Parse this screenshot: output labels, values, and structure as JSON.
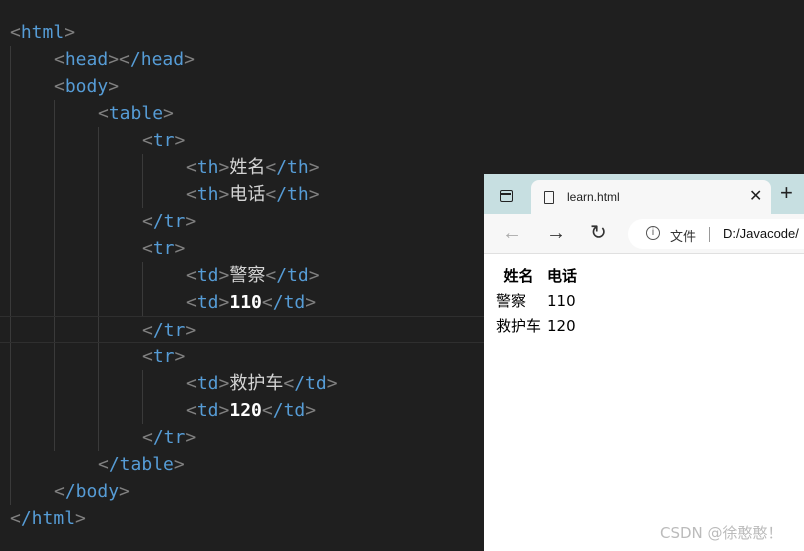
{
  "editor": {
    "html_open": "html",
    "head_open": "head",
    "head_close": "/head",
    "body_open": "body",
    "table_open": "table",
    "tr": "tr",
    "tr_close": "/tr",
    "th": "th",
    "th_close": "/th",
    "td": "td",
    "td_close": "/td",
    "table_close": "/table",
    "body_close": "/body",
    "html_close": "/html",
    "th_name": "姓名",
    "th_phone": "电话",
    "row1_name": "警察",
    "row1_phone": "110",
    "row2_name": "救护车",
    "row2_phone": "120"
  },
  "browser": {
    "tab_title": "learn.html",
    "address_label": "文件",
    "address_url": "D:/Javacode/",
    "page_table": {
      "headers": [
        "姓名",
        "电话"
      ],
      "rows": [
        [
          "警察",
          "110"
        ],
        [
          "救护车",
          "120"
        ]
      ]
    }
  },
  "watermark": "CSDN @徐憨憨！"
}
